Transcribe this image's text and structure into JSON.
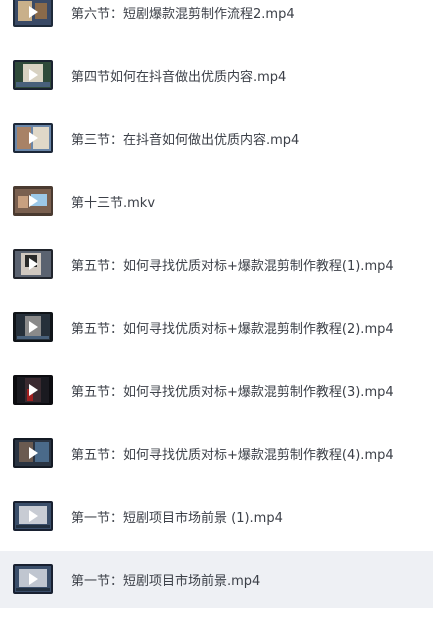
{
  "files": [
    {
      "name": "第六节：短剧爆款混剪制作流程2.mp4",
      "thumb_icon": "video-thumbnail-icon",
      "selected": false
    },
    {
      "name": "第四节如何在抖音做出优质内容.mp4",
      "thumb_icon": "video-thumbnail-icon",
      "selected": false
    },
    {
      "name": "第三节：在抖音如何做出优质内容.mp4",
      "thumb_icon": "video-thumbnail-icon",
      "selected": false
    },
    {
      "name": "第十三节.mkv",
      "thumb_icon": "video-thumbnail-icon",
      "selected": false
    },
    {
      "name": "第五节：如何寻找优质对标+爆款混剪制作教程(1).mp4",
      "thumb_icon": "video-thumbnail-icon",
      "selected": false
    },
    {
      "name": "第五节：如何寻找优质对标+爆款混剪制作教程(2).mp4",
      "thumb_icon": "video-thumbnail-icon",
      "selected": false
    },
    {
      "name": "第五节：如何寻找优质对标+爆款混剪制作教程(3).mp4",
      "thumb_icon": "video-thumbnail-icon",
      "selected": false
    },
    {
      "name": "第五节：如何寻找优质对标+爆款混剪制作教程(4).mp4",
      "thumb_icon": "video-thumbnail-icon",
      "selected": false
    },
    {
      "name": "第一节：短剧项目市场前景 (1).mp4",
      "thumb_icon": "video-thumbnail-icon",
      "selected": false
    },
    {
      "name": "第一节：短剧项目市场前景.mp4",
      "thumb_icon": "video-thumbnail-icon",
      "selected": true
    }
  ],
  "colors": {
    "text": "#3c4048",
    "selected_bg": "#eef0f4",
    "background": "#ffffff"
  }
}
